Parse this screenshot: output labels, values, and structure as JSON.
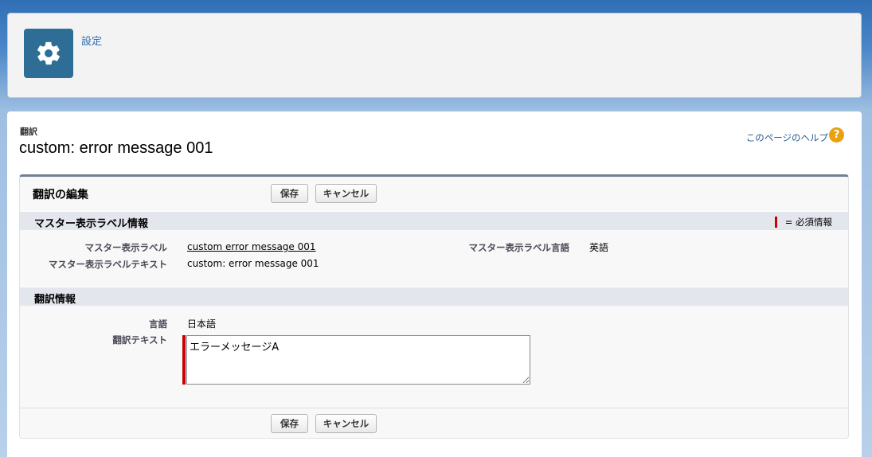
{
  "header": {
    "title": "設定"
  },
  "page": {
    "breadcrumb": "翻訳",
    "title": "custom: error message 001",
    "help_link": "このページのヘルプ",
    "help_icon": "question-icon"
  },
  "panel": {
    "title": "翻訳の編集",
    "save_label": "保存",
    "cancel_label": "キャンセル"
  },
  "master_section": {
    "title": "マスター表示ラベル情報",
    "required_legend": "= 必須情報",
    "fields": {
      "label_label": "マスター表示ラベル",
      "label_value": "custom error message 001",
      "text_label": "マスター表示ラベルテキスト",
      "text_value": "custom: error message 001",
      "lang_label": "マスター表示ラベル言語",
      "lang_value": "英語"
    }
  },
  "translation_section": {
    "title": "翻訳情報",
    "language_label": "言語",
    "language_value": "日本語",
    "text_label": "翻訳テキスト",
    "text_value": "エラーメッセージA"
  },
  "colors": {
    "accent": "#2e6e96",
    "required": "#cc0000",
    "help": "#e8a20f"
  }
}
